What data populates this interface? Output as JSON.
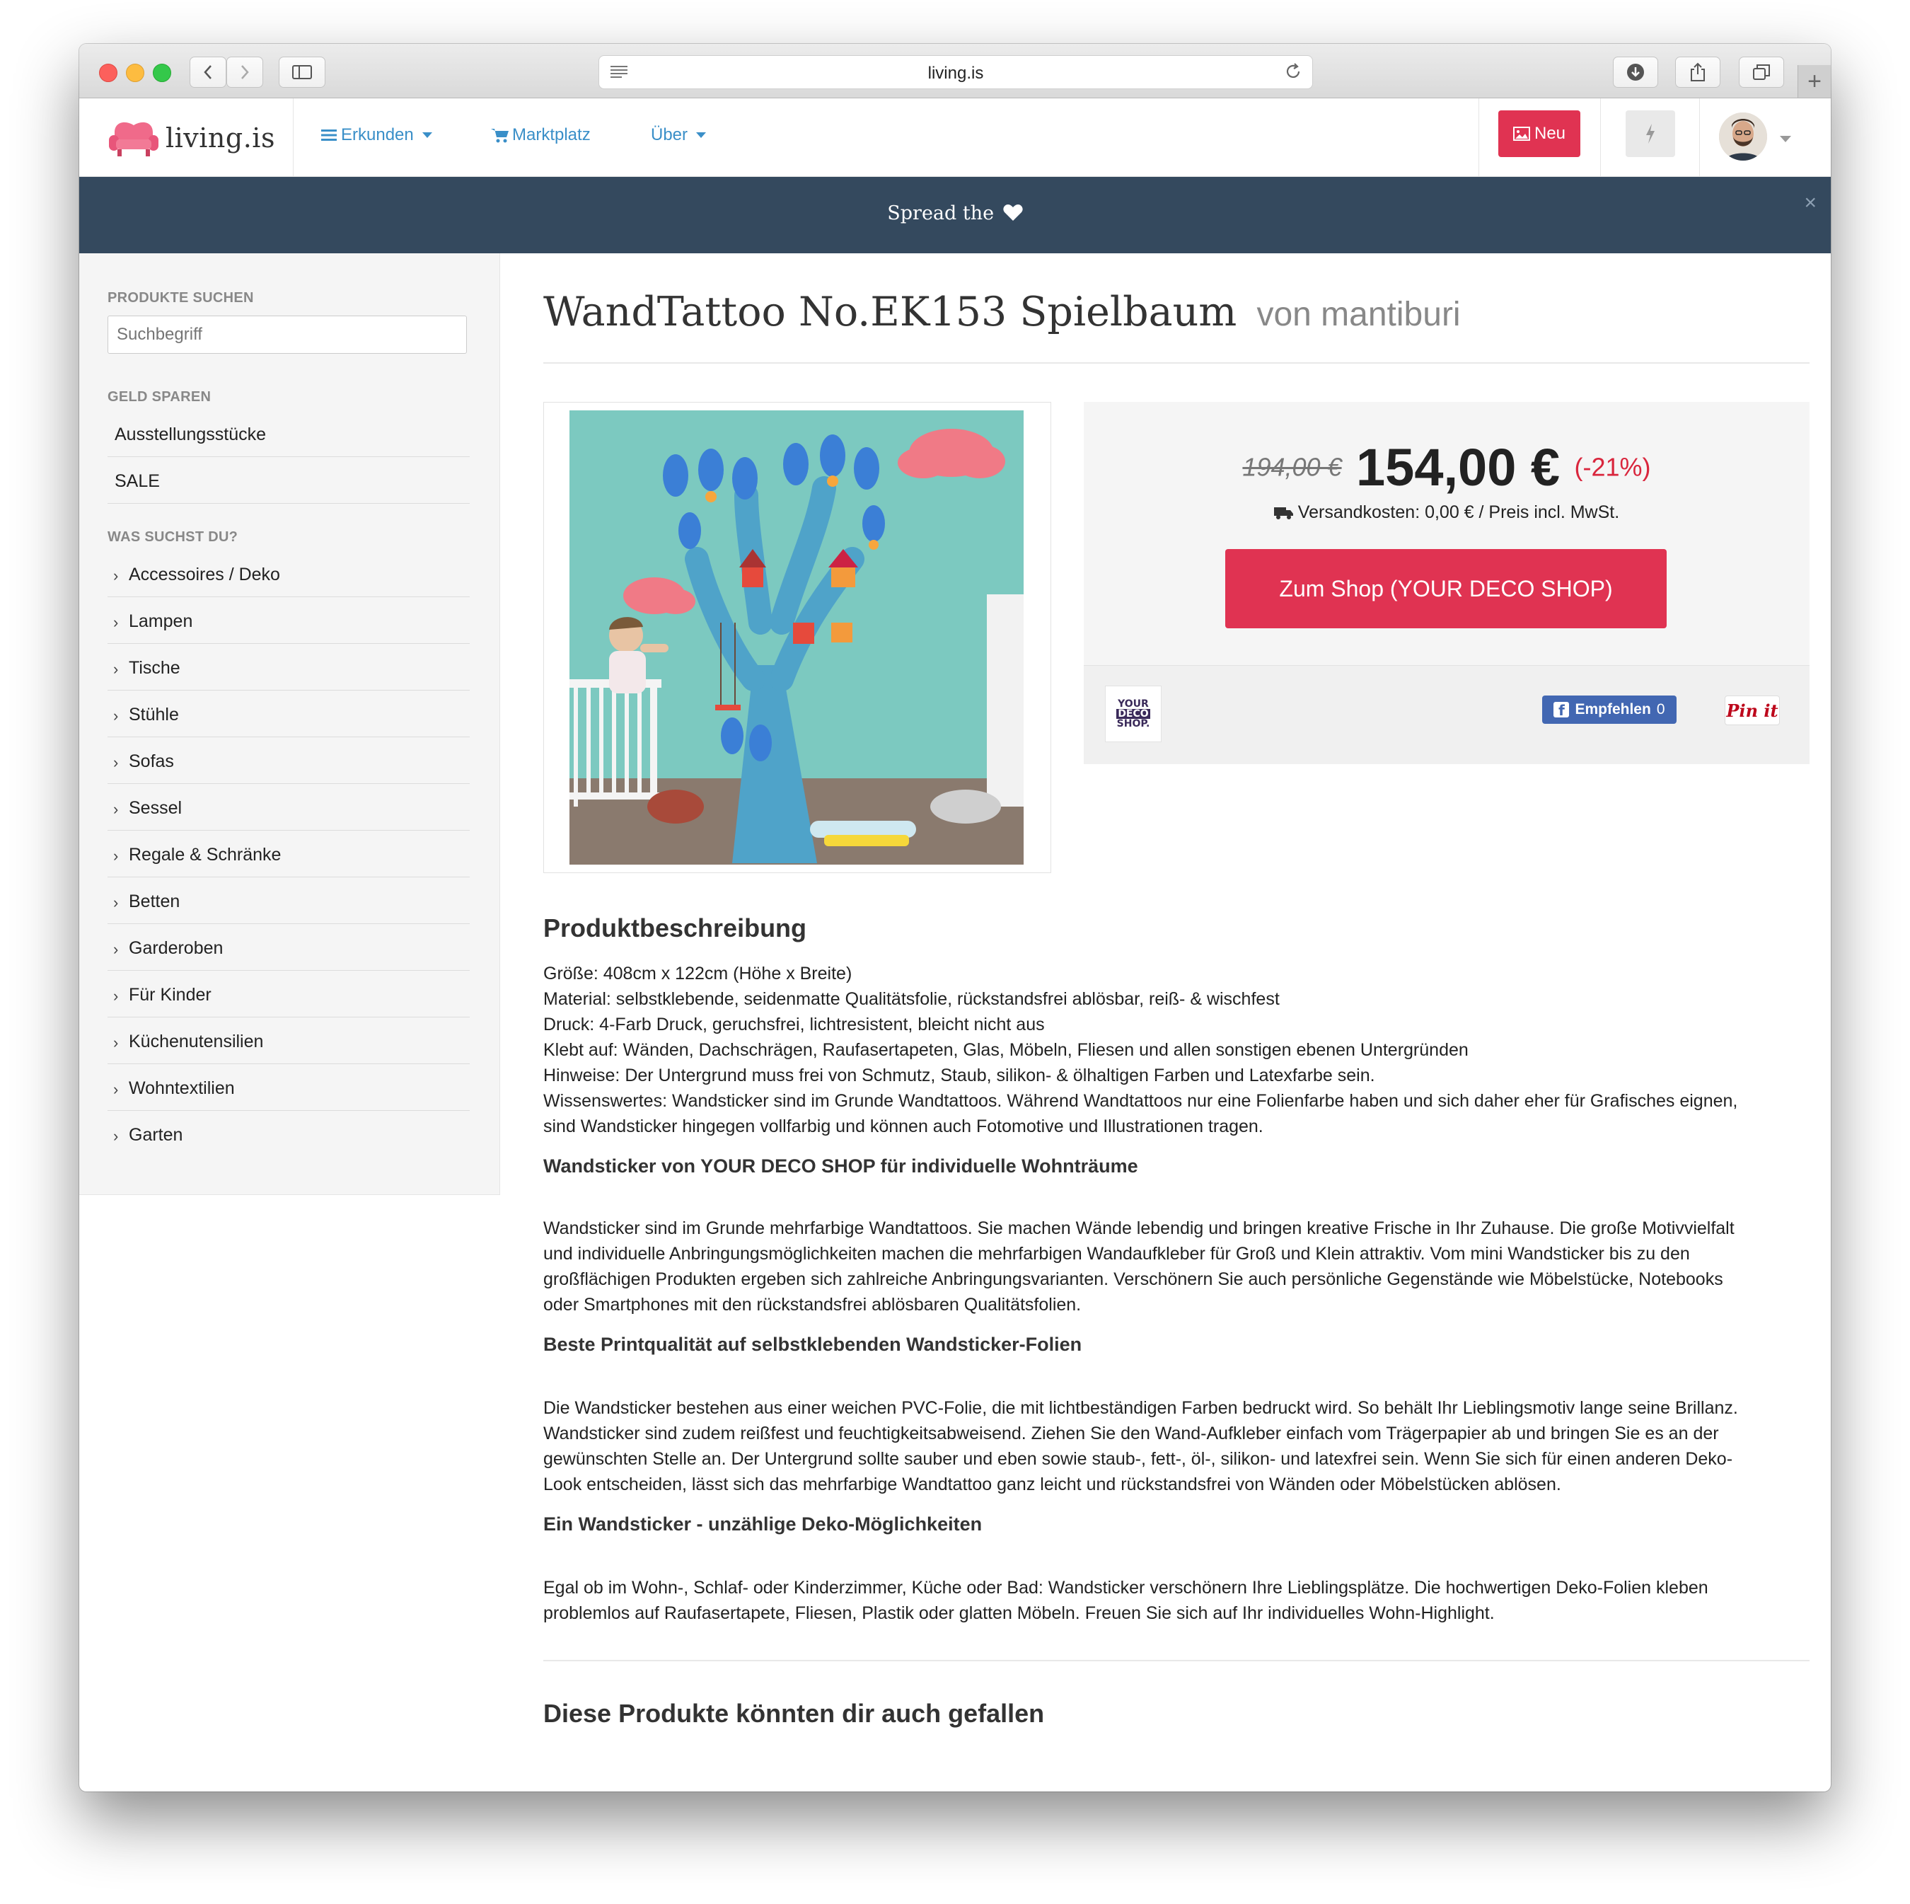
{
  "browser": {
    "url": "living.is"
  },
  "navbar": {
    "brand": "living.is",
    "links": [
      {
        "label": "Erkunden",
        "icon": "list-icon",
        "dropdown": true
      },
      {
        "label": "Marktplatz",
        "icon": "cart-icon",
        "dropdown": false
      },
      {
        "label": "Über",
        "icon": "",
        "dropdown": true
      }
    ],
    "new_label": "Neu"
  },
  "banner": {
    "text": "Spread the"
  },
  "sidebar": {
    "search_heading": "PRODUKTE SUCHEN",
    "search_placeholder": "Suchbegriff",
    "save_heading": "GELD SPAREN",
    "save_items": [
      "Ausstellungsstücke",
      "SALE"
    ],
    "categories_heading": "WAS SUCHST DU?",
    "categories": [
      "Accessoires / Deko",
      "Lampen",
      "Tische",
      "Stühle",
      "Sofas",
      "Sessel",
      "Regale & Schränke",
      "Betten",
      "Garderoben",
      "Für Kinder",
      "Küchenutensilien",
      "Wohntextilien",
      "Garten"
    ]
  },
  "product": {
    "title": "WandTattoo No.EK153 Spielbaum",
    "by": "von mantiburi",
    "old_price": "194,00 €",
    "price": "154,00 €",
    "discount": "(-21%)",
    "shipping": "Versandkosten: 0,00 € / Preis incl. MwSt.",
    "shop_button": "Zum Shop (YOUR DECO SHOP)",
    "shop_logo": [
      "YOUR",
      "DECO",
      "SHOP."
    ],
    "fb_label": "Empfehlen",
    "fb_count": "0",
    "pin_label": "Pin it"
  },
  "description": {
    "heading": "Produktbeschreibung",
    "spec_lines": [
      "Größe: 408cm x 122cm (Höhe x Breite)",
      "Material: selbstklebende, seidenmatte Qualitätsfolie, rückstandsfrei ablösbar, reiß- & wischfest",
      "Druck: 4-Farb Druck, geruchsfrei, lichtresistent, bleicht nicht aus",
      "Klebt auf: Wänden, Dachschrägen, Raufasertapeten, Glas, Möbeln, Fliesen und allen sonstigen ebenen Untergründen",
      "Hinweise: Der Untergrund muss frei von Schmutz, Staub, silikon- & ölhaltigen Farben und Latexfarbe sein.",
      "Wissenswertes: Wandsticker sind im Grunde Wandtattoos. Während Wandtattoos nur eine Folienfarbe haben und sich daher eher für Grafisches eignen,",
      "sind Wandsticker hingegen vollfarbig und können auch Fotomotive und Illustrationen tragen."
    ],
    "section1_title": "Wandsticker von YOUR DECO SHOP für individuelle Wohnträume",
    "section1_lines": [
      "Wandsticker sind im Grunde mehrfarbige Wandtattoos. Sie machen Wände lebendig und bringen kreative Frische in Ihr Zuhause. Die große Motivvielfalt",
      "und individuelle Anbringungsmöglichkeiten machen die mehrfarbigen Wandaufkleber für Groß und Klein attraktiv. Vom mini Wandsticker bis zu den",
      "großflächigen Produkten ergeben sich zahlreiche Anbringungsvarianten. Verschönern Sie auch persönliche Gegenstände wie Möbelstücke, Notebooks",
      "oder Smartphones mit den rückstandsfrei ablösbaren Qualitätsfolien."
    ],
    "section2_title": "Beste Printqualität auf selbstklebenden Wandsticker-Folien",
    "section2_lines": [
      "Die Wandsticker bestehen aus einer weichen PVC-Folie, die mit lichtbeständigen Farben bedruckt wird. So behält Ihr Lieblingsmotiv lange seine Brillanz.",
      "Wandsticker sind zudem reißfest und feuchtigkeitsabweisend. Ziehen Sie den Wand-Aufkleber einfach vom Trägerpapier ab und bringen Sie es an der",
      "gewünschten Stelle an. Der Untergrund sollte sauber und eben sowie staub-, fett-, öl-, silikon- und latexfrei sein. Wenn Sie sich für einen anderen Deko-",
      "Look entscheiden, lässt sich das mehrfarbige Wandtattoo ganz leicht und rückstandsfrei von Wänden oder Möbelstücken ablösen."
    ],
    "section3_title": "Ein Wandsticker - unzählige Deko-Möglichkeiten",
    "section3_lines": [
      "Egal ob im Wohn-, Schlaf- oder Kinderzimmer, Küche oder Bad: Wandsticker verschönern Ihre Lieblingsplätze. Die hochwertigen Deko-Folien kleben",
      "problemlos auf Raufasertapete, Fliesen, Plastik oder glatten Möbeln. Freuen Sie sich auf Ihr individuelles Wohn-Highlight."
    ],
    "related_heading": "Diese Produkte könnten dir auch gefallen"
  },
  "colors": {
    "accent_red": "#e03352",
    "link_blue": "#3a8fc8",
    "banner_bg": "#34495e",
    "discount_red": "#d9263d",
    "facebook_blue": "#4267b2"
  }
}
